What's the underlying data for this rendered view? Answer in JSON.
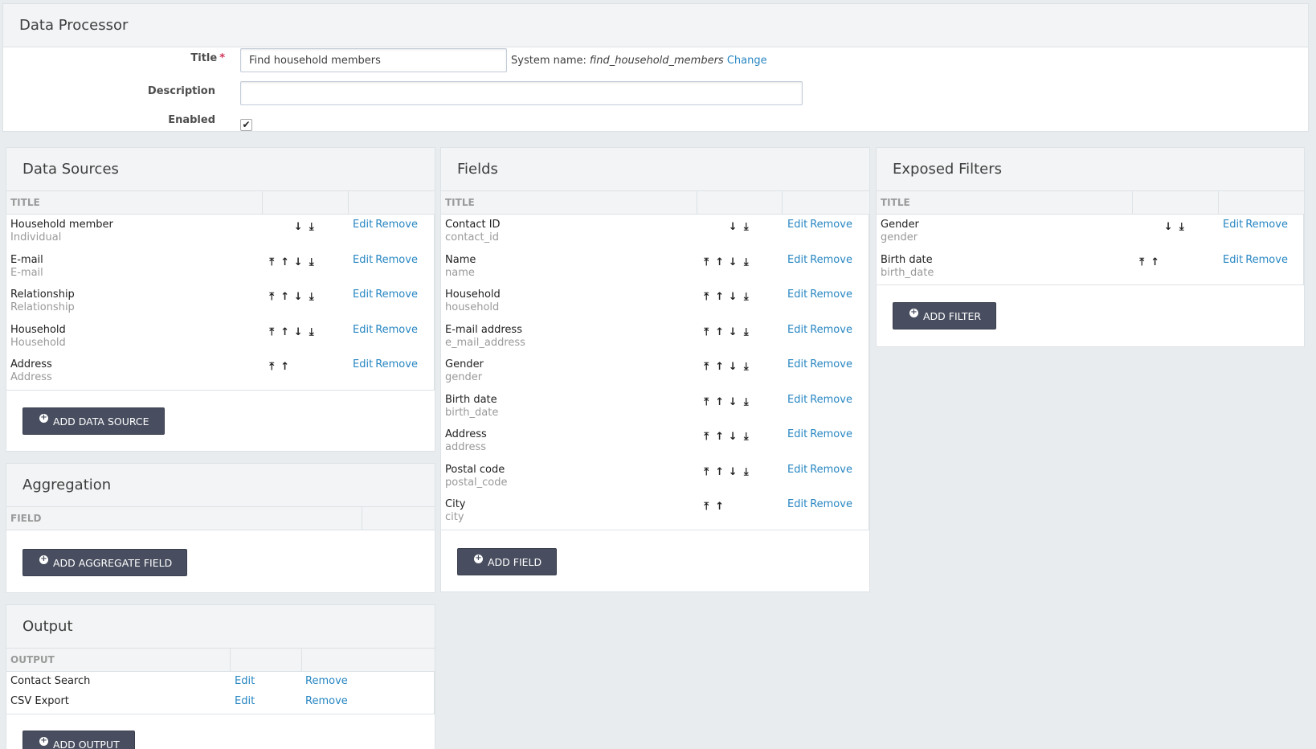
{
  "page": {
    "title": "Data Processor"
  },
  "form": {
    "title_label": "Title",
    "required_marker": "*",
    "title_value": "Find household members",
    "system_name_label": "System name:",
    "system_name_value": "find_household_members",
    "change_label": "Change",
    "description_label": "Description",
    "description_value": "",
    "enabled_label": "Enabled",
    "enabled_checked": true
  },
  "data_sources": {
    "heading": "Data Sources",
    "column": "TITLE",
    "rows": [
      {
        "title": "Household member",
        "subtitle": "Individual",
        "arrows": [
          "",
          "",
          "down",
          "bottom"
        ]
      },
      {
        "title": "E-mail",
        "subtitle": "E-mail",
        "arrows": [
          "top",
          "up",
          "down",
          "bottom"
        ]
      },
      {
        "title": "Relationship",
        "subtitle": "Relationship",
        "arrows": [
          "top",
          "up",
          "down",
          "bottom"
        ]
      },
      {
        "title": "Household",
        "subtitle": "Household",
        "arrows": [
          "top",
          "up",
          "down",
          "bottom"
        ]
      },
      {
        "title": "Address",
        "subtitle": "Address",
        "arrows": [
          "top",
          "up",
          "",
          ""
        ]
      }
    ],
    "edit_label": "Edit",
    "remove_label": "Remove",
    "add_button": "ADD DATA SOURCE"
  },
  "aggregation": {
    "heading": "Aggregation",
    "column": "FIELD",
    "add_button": "ADD AGGREGATE FIELD"
  },
  "output": {
    "heading": "Output",
    "column": "OUTPUT",
    "rows": [
      {
        "title": "Contact Search"
      },
      {
        "title": "CSV Export"
      }
    ],
    "edit_label": "Edit",
    "remove_label": "Remove",
    "add_button": "ADD OUTPUT"
  },
  "fields": {
    "heading": "Fields",
    "column": "TITLE",
    "rows": [
      {
        "title": "Contact ID",
        "subtitle": "contact_id",
        "arrows": [
          "",
          "",
          "down",
          "bottom"
        ]
      },
      {
        "title": "Name",
        "subtitle": "name",
        "arrows": [
          "top",
          "up",
          "down",
          "bottom"
        ]
      },
      {
        "title": "Household",
        "subtitle": "household",
        "arrows": [
          "top",
          "up",
          "down",
          "bottom"
        ]
      },
      {
        "title": "E-mail address",
        "subtitle": "e_mail_address",
        "arrows": [
          "top",
          "up",
          "down",
          "bottom"
        ]
      },
      {
        "title": "Gender",
        "subtitle": "gender",
        "arrows": [
          "top",
          "up",
          "down",
          "bottom"
        ]
      },
      {
        "title": "Birth date",
        "subtitle": "birth_date",
        "arrows": [
          "top",
          "up",
          "down",
          "bottom"
        ]
      },
      {
        "title": "Address",
        "subtitle": "address",
        "arrows": [
          "top",
          "up",
          "down",
          "bottom"
        ]
      },
      {
        "title": "Postal code",
        "subtitle": "postal_code",
        "arrows": [
          "top",
          "up",
          "down",
          "bottom"
        ]
      },
      {
        "title": "City",
        "subtitle": "city",
        "arrows": [
          "top",
          "up",
          "",
          ""
        ]
      }
    ],
    "edit_label": "Edit",
    "remove_label": "Remove",
    "add_button": "ADD FIELD"
  },
  "filters": {
    "heading": "Exposed Filters",
    "column": "TITLE",
    "rows": [
      {
        "title": "Gender",
        "subtitle": "gender",
        "arrows": [
          "",
          "",
          "down",
          "bottom"
        ]
      },
      {
        "title": "Birth date",
        "subtitle": "birth_date",
        "arrows": [
          "top",
          "up",
          "",
          ""
        ]
      }
    ],
    "edit_label": "Edit",
    "remove_label": "Remove",
    "add_button": "ADD FILTER"
  },
  "icons": {
    "top": "⤒",
    "up": "↑",
    "down": "↓",
    "bottom": "⤓",
    "plus": "+",
    "check": "✔"
  }
}
